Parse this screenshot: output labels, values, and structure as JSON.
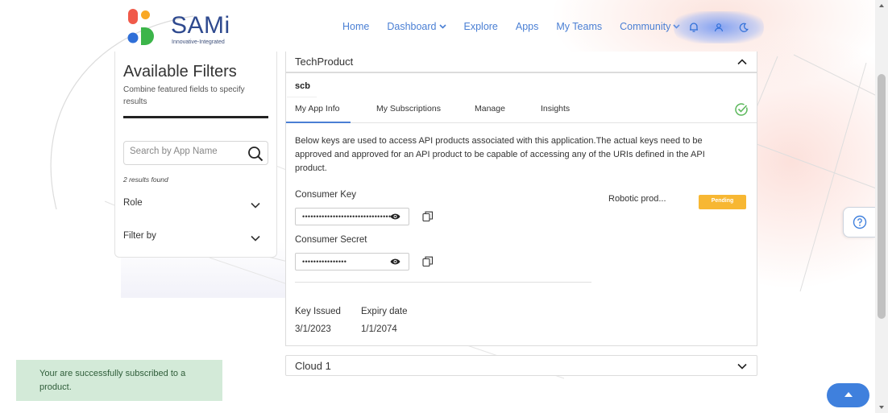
{
  "brand": {
    "name": "SAMi",
    "tagline": "Innovative-Integrated",
    "colors": {
      "red": "#f05a4a",
      "orange": "#f9a825",
      "blue": "#2f6fd8",
      "green": "#3cb54a",
      "text": "#2f4a8f"
    }
  },
  "nav": {
    "items": [
      {
        "label": "Home",
        "has_dropdown": false
      },
      {
        "label": "Dashboard",
        "has_dropdown": true
      },
      {
        "label": "Explore",
        "has_dropdown": false
      },
      {
        "label": "Apps",
        "has_dropdown": false
      },
      {
        "label": "My Teams",
        "has_dropdown": false
      },
      {
        "label": "Community",
        "has_dropdown": true
      }
    ],
    "icons": [
      "bell-icon",
      "user-icon",
      "moon-icon"
    ],
    "accent": "#4a7fd4"
  },
  "filters": {
    "title": "Available Filters",
    "subtitle": "Combine featured fields to specify results",
    "search_placeholder": "Search by App Name",
    "results_text": "2 results found",
    "groups": [
      {
        "label": "Role"
      },
      {
        "label": "Filter by"
      }
    ]
  },
  "product": {
    "title": "TechProduct",
    "app_name": "scb",
    "tabs": [
      {
        "label": "My App Info",
        "active": true
      },
      {
        "label": "My Subscriptions",
        "active": false
      },
      {
        "label": "Manage",
        "active": false
      },
      {
        "label": "Insights",
        "active": false
      }
    ],
    "description": "Below keys are used to access API products associated with this application.The actual keys need to be approved and approved for an API product to be capable of accessing any of the URIs defined in the API product.",
    "consumer_key_label": "Consumer Key",
    "consumer_key_value": "••••••••••••••••••••••••••••••••",
    "consumer_secret_label": "Consumer Secret",
    "consumer_secret_value": "••••••••••••••••",
    "api_product_name": "Robotic prod...",
    "status": "Pending",
    "status_color": "#f7b733",
    "key_issued_label": "Key Issued",
    "key_issued_value": "3/1/2023",
    "expiry_label": "Expiry date",
    "expiry_value": "1/1/2074"
  },
  "second_product": {
    "title": "Cloud 1"
  },
  "toast": {
    "message": "Your are successfully subscribed to a product."
  }
}
